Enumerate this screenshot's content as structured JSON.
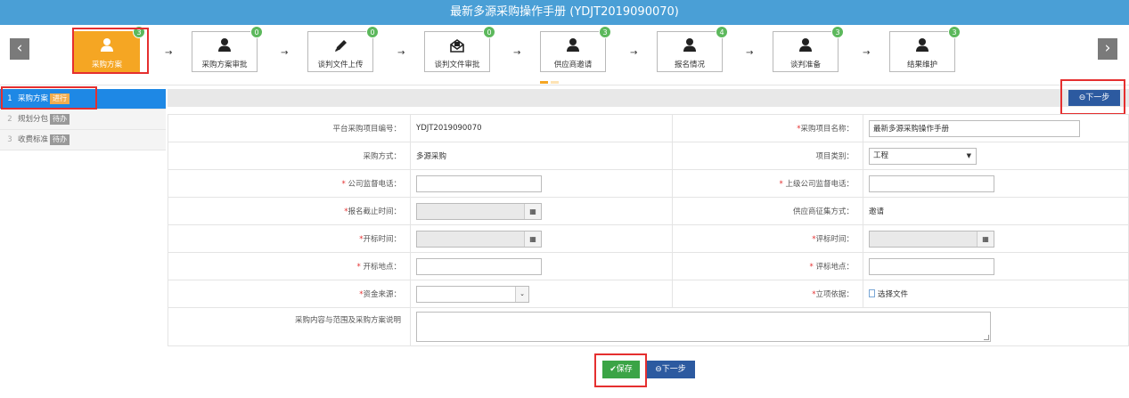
{
  "title": "最新多源采购操作手册 (YDJT2019090070)",
  "nav": {
    "prev_icon": "‹",
    "next_icon": "›",
    "arrow_glyph": "→"
  },
  "steps": [
    {
      "label": "采购方案",
      "count": "3",
      "icon": "user-icon",
      "active": true
    },
    {
      "label": "采购方案审批",
      "count": "0",
      "icon": "user-icon"
    },
    {
      "label": "谈判文件上传",
      "count": "0",
      "icon": "pencil-icon"
    },
    {
      "label": "谈判文件审批",
      "count": "0",
      "icon": "envelope-icon"
    },
    {
      "label": "供应商邀请",
      "count": "3",
      "icon": "user-icon"
    },
    {
      "label": "报名情况",
      "count": "4",
      "icon": "user-icon"
    },
    {
      "label": "谈判准备",
      "count": "3",
      "icon": "user-icon"
    },
    {
      "label": "结果维护",
      "count": "3",
      "icon": "user-icon"
    }
  ],
  "sidebar": {
    "items": [
      {
        "num": "1",
        "label": "采购方案",
        "status": "进行"
      },
      {
        "num": "2",
        "label": "规划分包",
        "status": "待办"
      },
      {
        "num": "3",
        "label": "收费标准",
        "status": "待办"
      }
    ]
  },
  "toolbar": {
    "next_label": "⊖下一步"
  },
  "form": {
    "project_no_label": "平台采购项目编号：",
    "project_no_value": "YDJT2019090070",
    "project_name_label": "采购项目名称：",
    "project_name_value": "最新多源采购操作手册",
    "method_label": "采购方式：",
    "method_value": "多源采购",
    "category_label": "项目类别：",
    "category_value": "工程",
    "supervise_phone_label": "公司监督电话：",
    "parent_phone_label": "上级公司监督电话：",
    "deadline_label": "报名截止时间：",
    "collect_label": "供应商征集方式：",
    "collect_value": "邀请",
    "open_time_label": "开标时间：",
    "eval_time_label": "评标时间：",
    "open_place_label": "开标地点：",
    "eval_place_label": "评标地点：",
    "fund_label": "资金来源：",
    "basis_label": "立项依据：",
    "basis_file": "选择文件",
    "content_label": "采购内容与范围及采购方案说明",
    "required_mark": "*"
  },
  "footer": {
    "save_label": "✔保存",
    "next_label": "⊖下一步"
  },
  "colors": {
    "titlebar": "#4a9fd6",
    "active_step": "#f5a623",
    "sidebar_active": "#1e88e5",
    "next_button": "#2c5aa0",
    "save_button": "#3ba446",
    "highlight": "#e52f2f",
    "badge": "#5cb85c"
  }
}
